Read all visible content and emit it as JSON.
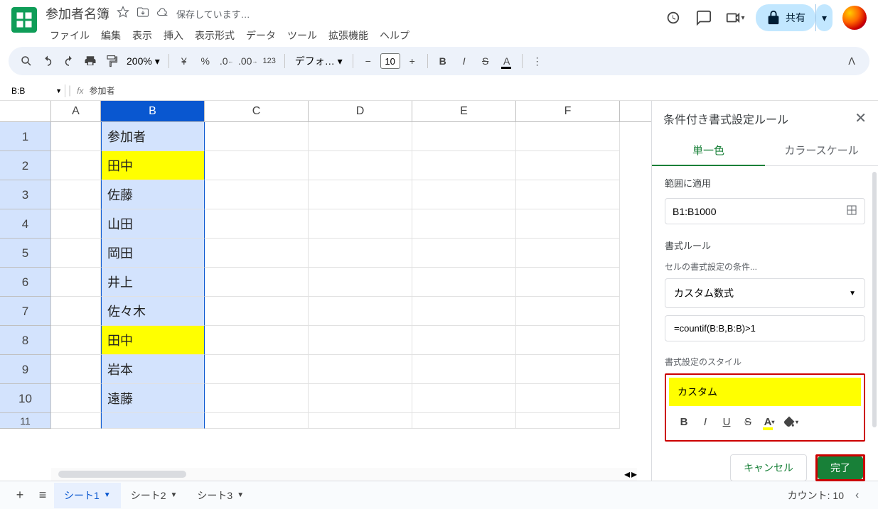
{
  "document": {
    "title": "参加者名簿",
    "saving": "保存しています…"
  },
  "menu": {
    "file": "ファイル",
    "edit": "編集",
    "view": "表示",
    "insert": "挿入",
    "format": "表示形式",
    "data": "データ",
    "tools": "ツール",
    "extensions": "拡張機能",
    "help": "ヘルプ"
  },
  "toolbar": {
    "zoom": "200%",
    "currency": "¥",
    "percent": "%",
    "font": "デフォ…",
    "size": "10"
  },
  "share": {
    "label": "共有"
  },
  "formula_bar": {
    "name_box": "B:B",
    "value": "参加者"
  },
  "columns": [
    "A",
    "B",
    "C",
    "D",
    "E",
    "F"
  ],
  "rows": [
    {
      "num": "1",
      "b": "参加者",
      "highlight": false
    },
    {
      "num": "2",
      "b": "田中",
      "highlight": true
    },
    {
      "num": "3",
      "b": "佐藤",
      "highlight": false
    },
    {
      "num": "4",
      "b": "山田",
      "highlight": false
    },
    {
      "num": "5",
      "b": "岡田",
      "highlight": false
    },
    {
      "num": "6",
      "b": "井上",
      "highlight": false
    },
    {
      "num": "7",
      "b": "佐々木",
      "highlight": false
    },
    {
      "num": "8",
      "b": "田中",
      "highlight": true
    },
    {
      "num": "9",
      "b": "岩本",
      "highlight": false
    },
    {
      "num": "10",
      "b": "遠藤",
      "highlight": false
    }
  ],
  "row11": "11",
  "sidebar": {
    "title": "条件付き書式設定ルール",
    "tab_single": "単一色",
    "tab_scale": "カラースケール",
    "range_label": "範囲に適用",
    "range_value": "B1:B1000",
    "rules_label": "書式ルール",
    "criteria_label": "セルの書式設定の条件...",
    "criteria_value": "カスタム数式",
    "formula_value": "=countif(B:B,B:B)>1",
    "style_label": "書式設定のスタイル",
    "custom_label": "カスタム",
    "cancel": "キャンセル",
    "done": "完了"
  },
  "bottom": {
    "sheet1": "シート1",
    "sheet2": "シート2",
    "sheet3": "シート3",
    "count": "カウント: 10"
  }
}
